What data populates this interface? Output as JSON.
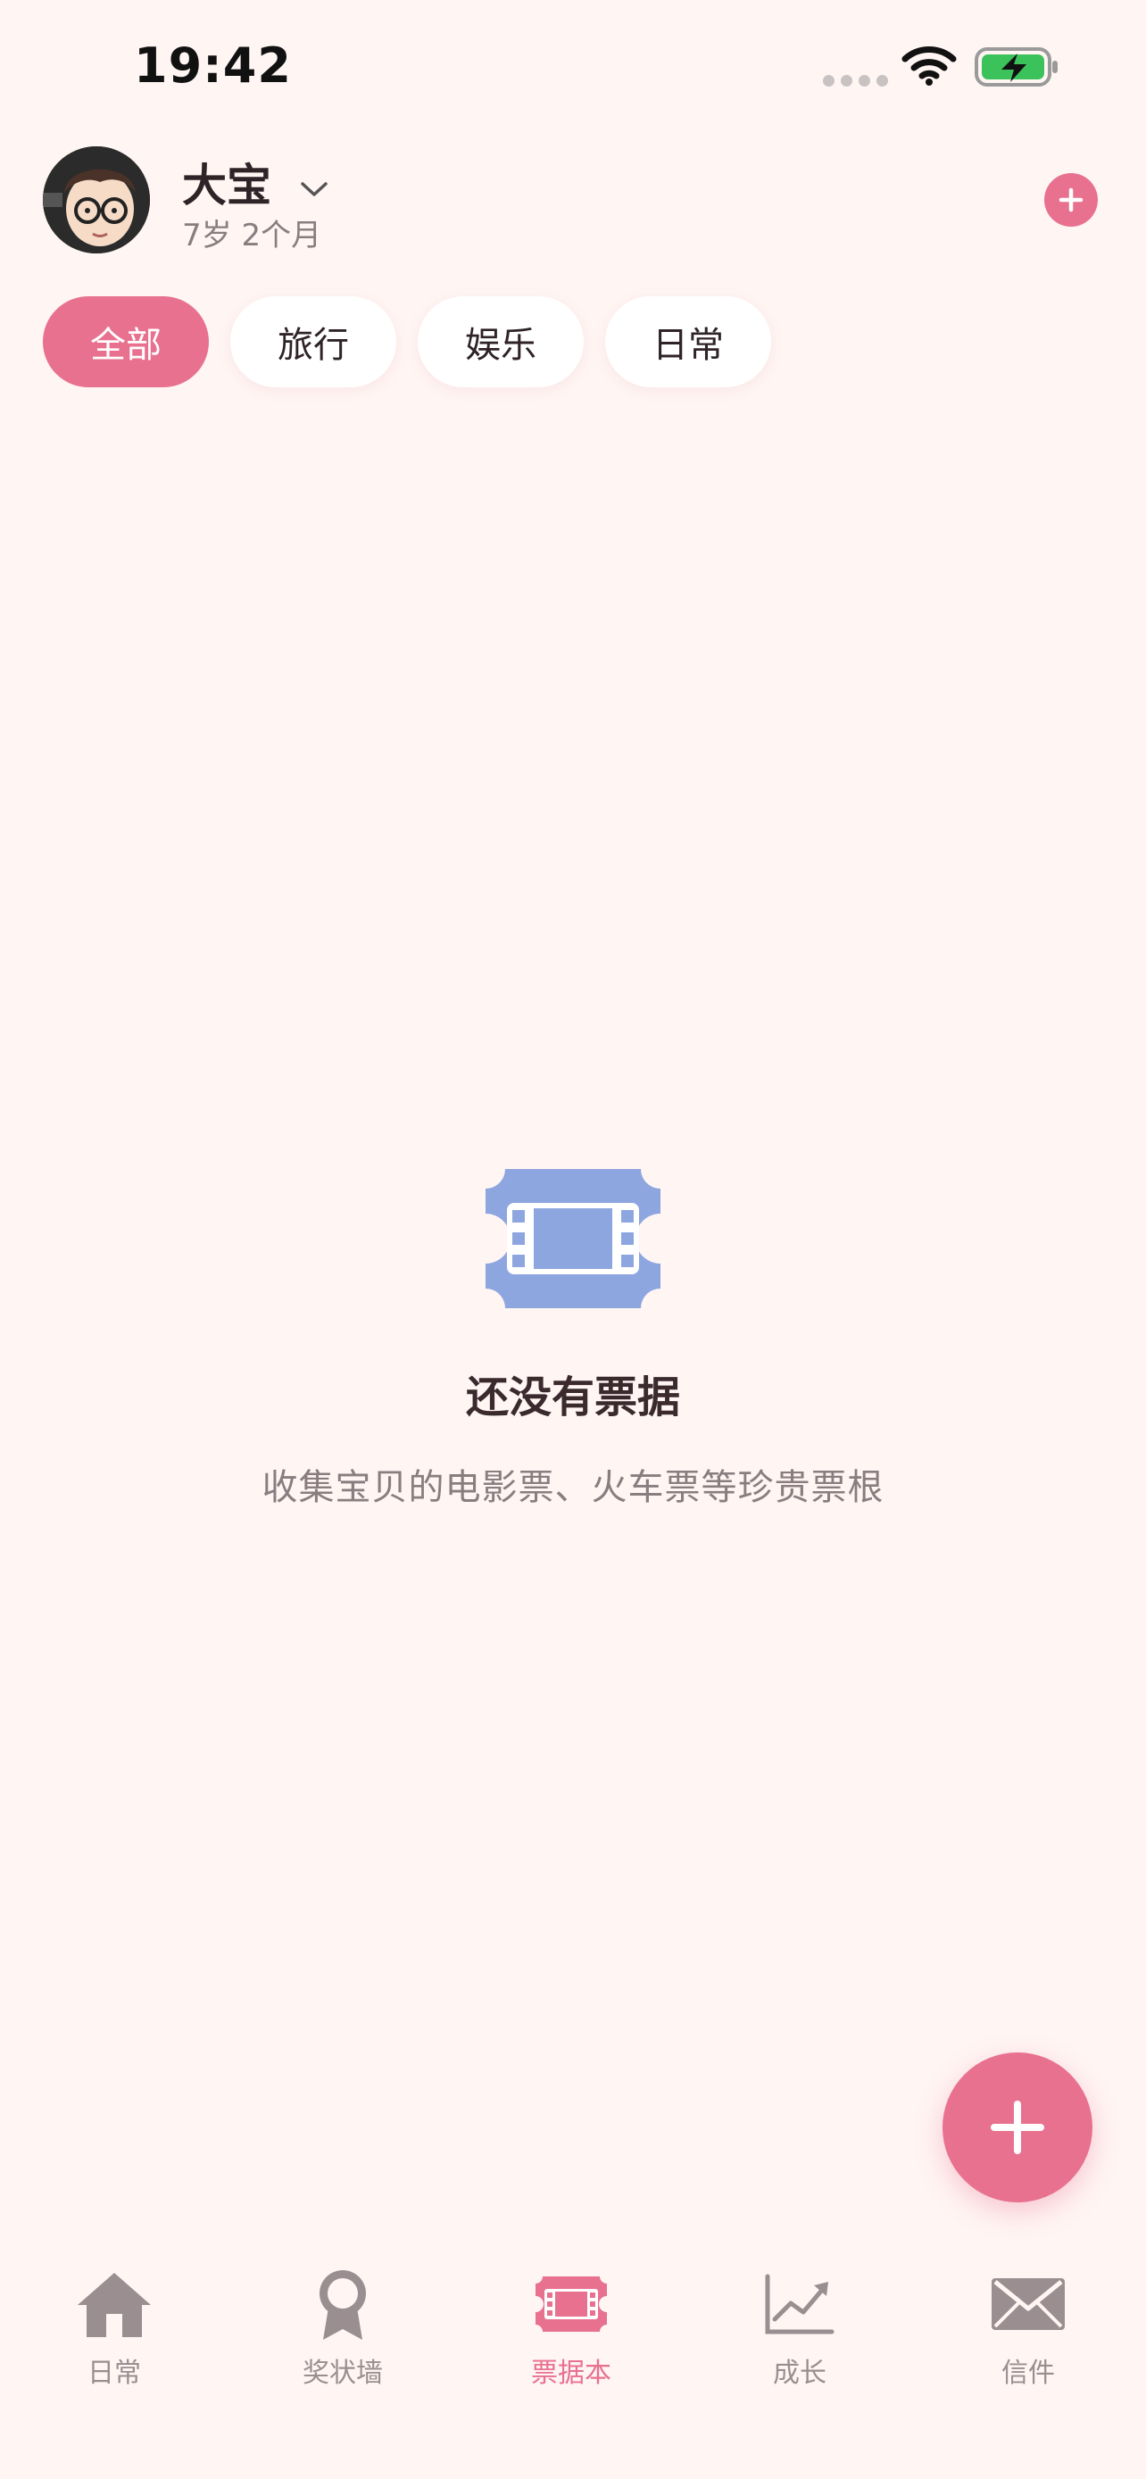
{
  "status_bar": {
    "time": "19:42",
    "icons": [
      "signal-dots-icon",
      "wifi-icon",
      "battery-charging-icon"
    ],
    "battery_color": "#3cc25b"
  },
  "header": {
    "avatar_icon": "avatar-cartoon-boy-glasses",
    "name": "大宝",
    "age": "7岁 2个月",
    "add_icon": "plus-icon"
  },
  "filters": {
    "active_index": 0,
    "items": [
      {
        "label": "全部"
      },
      {
        "label": "旅行"
      },
      {
        "label": "娱乐"
      },
      {
        "label": "日常"
      }
    ]
  },
  "empty_state": {
    "icon": "ticket-film-icon",
    "icon_color": "#8ea6e0",
    "title": "还没有票据",
    "subtitle": "收集宝贝的电影票、火车票等珍贵票根"
  },
  "fab": {
    "icon": "plus-icon"
  },
  "tab_bar": {
    "active_index": 2,
    "items": [
      {
        "label": "日常",
        "icon": "home-icon"
      },
      {
        "label": "奖状墙",
        "icon": "award-ribbon-icon"
      },
      {
        "label": "票据本",
        "icon": "ticket-icon"
      },
      {
        "label": "成长",
        "icon": "growth-chart-icon"
      },
      {
        "label": "信件",
        "icon": "envelope-icon"
      }
    ]
  },
  "colors": {
    "accent": "#e8718f",
    "background": "#fff5f3",
    "muted_text": "#8a7d80",
    "inactive_icon": "#9a8e90"
  }
}
